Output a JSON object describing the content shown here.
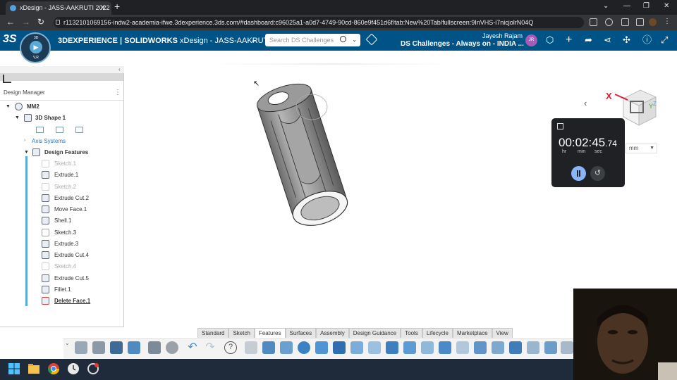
{
  "browser": {
    "tab_title": "xDesign - JASS-AAKRUTI 2022",
    "tab_close": "✕",
    "new_tab": "+",
    "url": "r1132101069156-indw2-academia-ifwe.3dexperience.3ds.com/#dashboard:c96025a1-a0d7-4749-90cd-860e9f451d6f/tab:New%20Tab/fullscreen:9InVHS-i7nicjolrN04Q",
    "nav_back": "←",
    "nav_forward": "→",
    "nav_reload": "↻",
    "win_min": "—",
    "win_max": "❐",
    "win_close": "✕",
    "win_chevron": "⌄"
  },
  "header": {
    "ds_logo": "3S",
    "compass_north": "3D",
    "compass_vr": "V,R",
    "brand_bold": "3DEXPERIENCE | SOLIDWORKS",
    "app_title": " xDesign - JASS-AAKRUTI ...",
    "search_placeholder": "Search DS Challenges",
    "user_name": "Jayesh Rajam",
    "user_initials": "JR",
    "community": "DS Challenges - Always on - INDIA ..."
  },
  "design_manager": {
    "title": "Design Manager",
    "menu": "⋮",
    "tree": [
      {
        "label": "MM2",
        "style": "bold"
      },
      {
        "label": "3D Shape 1",
        "style": "bold"
      },
      {
        "label": "Axis Systems",
        "style": "blue"
      },
      {
        "label": "Design Features",
        "style": "bold"
      },
      {
        "label": "Sketch.1",
        "style": "dim"
      },
      {
        "label": "Extrude.1",
        "style": ""
      },
      {
        "label": "Sketch.2",
        "style": "dim"
      },
      {
        "label": "Extrude Cut.2",
        "style": ""
      },
      {
        "label": "Move Face.1",
        "style": ""
      },
      {
        "label": "Shell.1",
        "style": ""
      },
      {
        "label": "Sketch.3",
        "style": ""
      },
      {
        "label": "Extrude.3",
        "style": ""
      },
      {
        "label": "Extrude Cut.4",
        "style": ""
      },
      {
        "label": "Sketch.4",
        "style": "dim"
      },
      {
        "label": "Extrude Cut.5",
        "style": ""
      },
      {
        "label": "Fillet.1",
        "style": ""
      },
      {
        "label": "Delete Face.1",
        "style": "underline"
      }
    ]
  },
  "viewport": {
    "unit": "mm",
    "axis_x": "X",
    "axis_y": "Y",
    "axis_z": "Z"
  },
  "timer": {
    "time_main": "00:02:45",
    "time_frac": ".74",
    "label_hr": "hr",
    "label_min": "min",
    "label_sec": "sec",
    "reset": "↺"
  },
  "action_bar": {
    "tabs": [
      "Standard",
      "Sketch",
      "Features",
      "Surfaces",
      "Assembly",
      "Design Guidance",
      "Tools",
      "Lifecycle",
      "Marketplace",
      "View"
    ],
    "active_tab": "Features"
  },
  "colors": {
    "header_bg": "#005386",
    "accent": "#5aa9d6",
    "timer_bg": "#202124"
  }
}
